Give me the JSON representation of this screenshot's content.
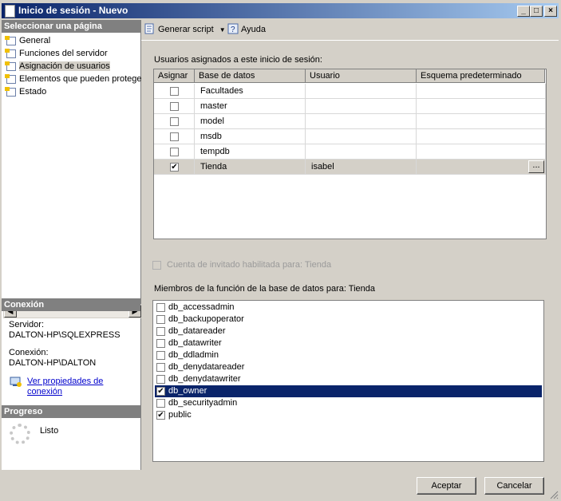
{
  "window": {
    "title": "Inicio de sesión - Nuevo"
  },
  "left": {
    "select_page_header": "Seleccionar una página",
    "pages": [
      "General",
      "Funciones del servidor",
      "Asignación de usuarios",
      "Elementos que pueden protege",
      "Estado"
    ],
    "selected_page_index": 2,
    "connection_header": "Conexión",
    "server_label": "Servidor:",
    "server_value": "DALTON-HP\\SQLEXPRESS",
    "connection_label": "Conexión:",
    "connection_value": "DALTON-HP\\DALTON",
    "view_props_link_line1": "Ver propiedades de",
    "view_props_link_line2": "conexión",
    "progress_header": "Progreso",
    "progress_status": "Listo"
  },
  "toolbar": {
    "script_label": "Generar script",
    "help_label": "Ayuda"
  },
  "mapping": {
    "label": "Usuarios asignados a este inicio de sesión:",
    "columns": [
      "Asignar",
      "Base de datos",
      "Usuario",
      "Esquema predeterminado"
    ],
    "rows": [
      {
        "checked": false,
        "database": "Facultades",
        "user": "",
        "schema": ""
      },
      {
        "checked": false,
        "database": "master",
        "user": "",
        "schema": ""
      },
      {
        "checked": false,
        "database": "model",
        "user": "",
        "schema": ""
      },
      {
        "checked": false,
        "database": "msdb",
        "user": "",
        "schema": ""
      },
      {
        "checked": false,
        "database": "tempdb",
        "user": "",
        "schema": ""
      },
      {
        "checked": true,
        "database": "Tienda",
        "user": "isabel",
        "schema": "",
        "selected": true
      }
    ],
    "ellipsis_label": "..."
  },
  "guest": {
    "label": "Cuenta de invitado habilitada para: Tienda",
    "checked": false,
    "enabled": false
  },
  "roles": {
    "label": "Miembros de la función de la base de datos para: Tienda",
    "items": [
      {
        "name": "db_accessadmin",
        "checked": false
      },
      {
        "name": "db_backupoperator",
        "checked": false
      },
      {
        "name": "db_datareader",
        "checked": false
      },
      {
        "name": "db_datawriter",
        "checked": false
      },
      {
        "name": "db_ddladmin",
        "checked": false
      },
      {
        "name": "db_denydatareader",
        "checked": false
      },
      {
        "name": "db_denydatawriter",
        "checked": false
      },
      {
        "name": "db_owner",
        "checked": true,
        "selected": true
      },
      {
        "name": "db_securityadmin",
        "checked": false
      },
      {
        "name": "public",
        "checked": true
      }
    ]
  },
  "buttons": {
    "ok": "Aceptar",
    "cancel": "Cancelar"
  },
  "check_glyph": "✔"
}
